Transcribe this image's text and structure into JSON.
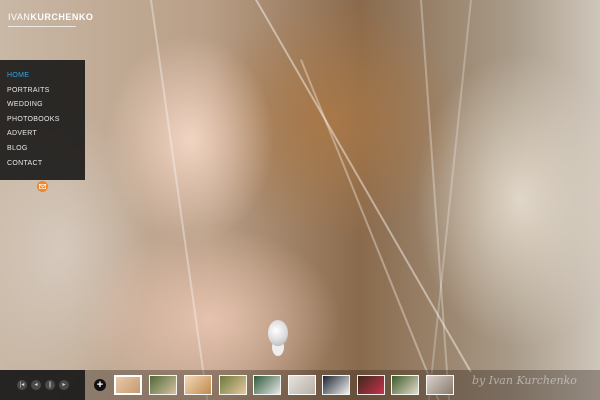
{
  "logo": {
    "light": "IVAN",
    "bold": "KURCHENKO"
  },
  "nav": {
    "items": [
      {
        "label": "HOME",
        "active": true
      },
      {
        "label": "PORTRAITS",
        "active": false
      },
      {
        "label": "WEDDING",
        "active": false
      },
      {
        "label": "PHOTOBOOKS",
        "active": false
      },
      {
        "label": "ADVERT",
        "active": false
      },
      {
        "label": "BLOG",
        "active": false
      },
      {
        "label": "CONTACT",
        "active": false
      }
    ],
    "active_color": "#2ea7e8"
  },
  "mail_icon": "envelope-icon",
  "slideshow_controls": [
    {
      "icon": "first-slide-icon",
      "glyph": "|◂"
    },
    {
      "icon": "previous-icon",
      "glyph": "◂"
    },
    {
      "icon": "pause-icon",
      "glyph": "||"
    },
    {
      "icon": "next-icon",
      "glyph": "▸"
    }
  ],
  "thumbnails_toggle": {
    "icon": "plus-icon",
    "glyph": "+"
  },
  "thumbnails": [
    {
      "active": true,
      "colors": [
        "#e9c9a8",
        "#c49a70"
      ]
    },
    {
      "active": false,
      "colors": [
        "#4f6b3a",
        "#d8c0a0"
      ]
    },
    {
      "active": false,
      "colors": [
        "#f1d9b8",
        "#c08a50"
      ]
    },
    {
      "active": false,
      "colors": [
        "#6a7a3c",
        "#e8c8a0"
      ]
    },
    {
      "active": false,
      "colors": [
        "#2f5a3a",
        "#e8e8e8"
      ]
    },
    {
      "active": false,
      "colors": [
        "#e6e2dc",
        "#b8b0a8"
      ]
    },
    {
      "active": false,
      "colors": [
        "#1c2430",
        "#f2f2f2"
      ]
    },
    {
      "active": false,
      "colors": [
        "#3a2a1e",
        "#c8324a"
      ]
    },
    {
      "active": false,
      "colors": [
        "#3c5a2a",
        "#e6dccb"
      ]
    },
    {
      "active": false,
      "colors": [
        "#d8d2cc",
        "#8a7a6c"
      ]
    }
  ],
  "watermark": "by Ivan Kurchenko",
  "accent_color": "#f0862b"
}
